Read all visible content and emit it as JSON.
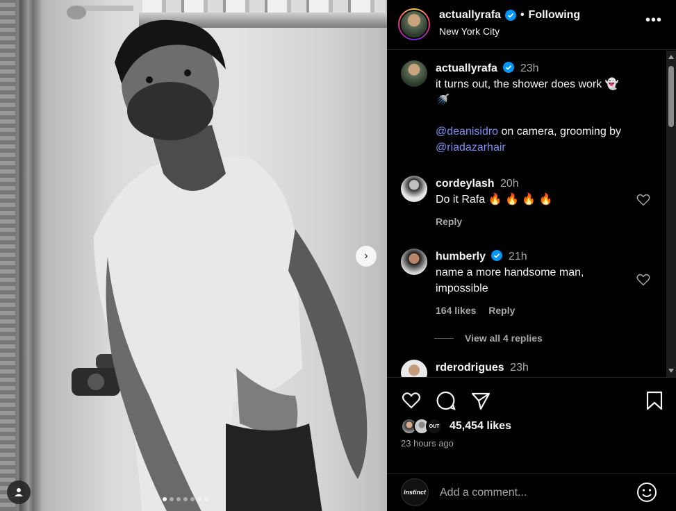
{
  "header": {
    "username": "actuallyrafa",
    "separator": "•",
    "follow_label": "Following",
    "location": "New York City",
    "more_label": "•••"
  },
  "caption": {
    "username": "actuallyrafa",
    "time": "23h",
    "text_line1": "it turns out, the shower does work 👻",
    "text_line2": "🚿",
    "mention1": "@deanisidro",
    "text_mid": " on camera, grooming by",
    "mention2": "@riadazarhair"
  },
  "comments": [
    {
      "username": "cordeylash",
      "time": "20h",
      "text": "Do it Rafa 🔥 🔥 🔥 🔥",
      "reply_label": "Reply"
    },
    {
      "username": "humberly",
      "time": "21h",
      "text": "name a more handsome man, impossible",
      "likes_label": "164 likes",
      "reply_label": "Reply",
      "view_replies": "View all 4 replies"
    },
    {
      "username": "rderodrigues",
      "time": "23h"
    }
  ],
  "likes": {
    "count_label": "45,454 likes",
    "time_ago": "23 hours ago"
  },
  "composer": {
    "avatar_label": "instinct",
    "placeholder": "Add a comment..."
  },
  "carousel": {
    "total_slides": 7,
    "active_index": 0,
    "next_label": "›"
  },
  "colors": {
    "accent_mention": "#7d8ff5",
    "verified": "#0095f6",
    "muted": "#a8a8a8"
  }
}
